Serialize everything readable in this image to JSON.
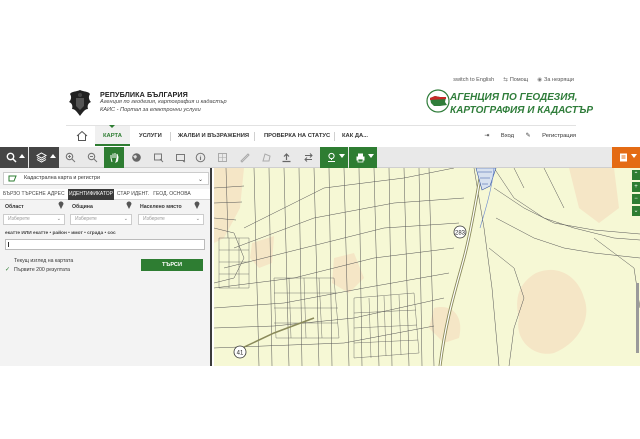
{
  "top_links": {
    "english": "switch to English",
    "help": "Помощ",
    "accessibility": "За незрящи"
  },
  "header": {
    "republic": "РЕПУБЛИКА БЪЛГАРИЯ",
    "agency_line": "Агенция по геодезия, картография и кадастър",
    "portal_line": "КАИС - Портал за електронни услуги",
    "logo_line1": "АГЕНЦИЯ ПО ГЕОДЕЗИЯ,",
    "logo_line2": "КАРТОГРАФИЯ И КАДАСТЪР"
  },
  "nav": {
    "items": [
      {
        "label": "КАРТА",
        "active": true
      },
      {
        "label": "УСЛУГИ"
      },
      {
        "label": "ЖАЛБИ И ВЪЗРАЖЕНИЯ"
      },
      {
        "label": "ПРОВЕРКА НА СТАТУС"
      },
      {
        "label": "КАК ДА..."
      }
    ],
    "login": "Вход",
    "register": "Регистрация"
  },
  "panel": {
    "layer_select": "Кадастрална карта и регистри",
    "tabs": [
      "БЪРЗО ТЪРСЕНЕ",
      "АДРЕС",
      "ИДЕНТИФИКАТОР",
      "СТАР ИДЕНТ.",
      "ГЕОД. ОСНОВА"
    ],
    "fields": {
      "oblast": {
        "label": "Област",
        "placeholder": "Изберете"
      },
      "obshtina": {
        "label": "Община",
        "placeholder": "Изберете"
      },
      "naseleno": {
        "label": "Населено място",
        "placeholder": "Изберете"
      }
    },
    "search_hint": "екатте ИЛИ екатте • район • имот • сграда • сос",
    "current_view": "Текущ изглед на картата",
    "first_200": "Първите 200 резултата",
    "search_button": "ТЪРСИ"
  },
  "map": {
    "road_label_1": "283",
    "road_label_2": "41"
  },
  "colors": {
    "brand_green": "#2e7d32",
    "map_base": "#f6f8d5",
    "orange": "#e46b14"
  }
}
